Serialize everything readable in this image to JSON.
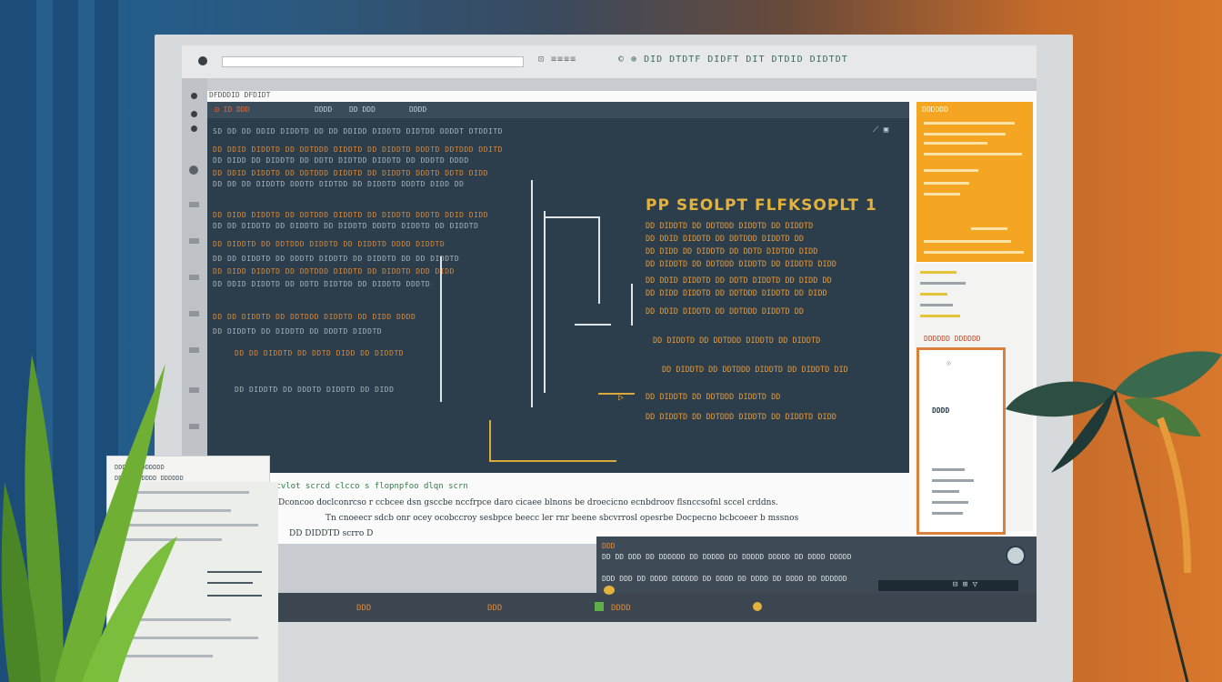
{
  "browser": {
    "toolbar_text": "© ⊕ DID DTDTF DIDFT DIT  DTDID DIDTDT"
  },
  "breadcrumb": "DFDDDID DFDIDT",
  "editor": {
    "tabs": [
      {
        "label": "⊡ ID  DDD"
      },
      {
        "label": "DDDD"
      },
      {
        "label": "DD DDD"
      },
      {
        "label": "DDDD"
      }
    ],
    "code_lines": [
      "SD DD DD  DDID DIDDTD  DD DD DDIDD DIDDTD DIDTDD DDDDT DTDDITD",
      "DD DDID DIDDTD  DD DDTDDD DIDDTD DD DIDDTD DDDTD DDTDDD DDITD",
      "DD DIDD DD DIDDTD DD DDTD DIDTDD DIDDTD DD DDDTD DDDD",
      "DD DDID DIDDTD DD DDTDDD DIDDTD DD DIDDTD DDDTD DDTD DIDD",
      "DD DD DD DIDDTD DDDTD DIDTDD DD DIDDTD DDDTD DIDD DD",
      "DD DIDD DIDDTD DD DDTDDD DIDDTD DD DIDDTD DDDTD DDID DIDD",
      "DD DD DIDDTD DD DIDDTD DD DIDDTD DDDTD DIDDTD DD DIDDTD",
      "DD DIDDTD DD DDTDDD DIDDTD DD DIDDTD DDDD DIDDTD",
      "DD DD DIDDTD DD DDDTD DIDDTD DD DIDDTD DD DD DIDDTD",
      "DD DIDD DIDDTD DD DDTDDD DIDDTD DD DIDDTD DDD DIDD",
      "DD DDID DIDDTD DD DDTD DIDTDD DD DIDDTD DDDTD",
      "DD DD DIDDTD DD DDTDDD DIDDTD DD DIDD DDDD",
      "DD DIDDTD DD DIDDTD DD DDDTD DIDDTD",
      "DD DD DIDDTD DD DDTD DIDD DD DIDDTD",
      "DD DIDDTD DD DDDTD DIDDTD DD DIDD"
    ],
    "panel_title": "PP SEOLPT FLFKSOPLT 1",
    "panel_lines": [
      "DD DIDDTD DD DDTDDD DIDDTD DD DIDDTD",
      "DD DDID DIDDTD DD DDTDDD DIDDTD DD",
      "DD DIDD DD DIDDTD DD DDTD DIDTDD DIDD",
      "DD DIDDTD DD DDTDDD DIDDTD DD DIDDTD DIDD",
      "DD DDID DIDDTD DD DDTD DIDDTD DD DIDD DD",
      "DD DIDD DIDDTD DD DDTDDD DIDDTD DD DIDD",
      "DD DDID DIDDTD DD DDTDDD DIDDTD DD",
      "DD DIDDTD DD DDTDDD DIDDTD DD DIDDTD",
      "DD DIDDTD DD DDTDDD DIDDTD DD DIDDTD DID",
      "DD DIDDTD DD DDTDDD DIDDTD DD",
      "DD DIDDTD DD DDTDDD DIDDTD DD DIDDTD DIDD"
    ]
  },
  "right_panel": {
    "card_title": "DDDDDD",
    "doc_header": "DDDDDD DDDDDD",
    "doc_label": "DDDD"
  },
  "description": {
    "heading": "Dcvlot scrcd clcco s flopnpfoo dlqn scrn",
    "lines": [
      "Dconcoo doclconrcso r ccbcee dsn gsccbe nccfrpce daro cicaee blnons be  droecicno ecnbdroov flsnccsofnl sccel crddns.",
      "Tn cnoeecr sdcb  onr ocey ocobccroy sesbpce beecc ler rnr beene  sbcvrrosl  opesrbe  Docpecno bcbcoeer b mssnos",
      "DD DIDDTD scrro  D"
    ]
  },
  "status_panel": {
    "lines": [
      "DD  DD DDD  DD DDDDDD DD DDDDD DD DDDDD DDDDD DD DDDD DDDDD",
      "DDD DDD DD DDDD DDDDDD DD DDDD DD DDDD DD DDDD DD DDDDDD"
    ]
  },
  "dock": {
    "items": [
      "DDD",
      "DDD",
      "DDDD"
    ]
  },
  "paper": {
    "title": "DDDDDD  DDDDDD",
    "subtitle": "DDDDD DDDDD DDDDDD"
  },
  "colors": {
    "editor_bg": "#2c3d4b",
    "code_orange": "#d98a3a",
    "title_yellow": "#e3b23c",
    "card_amber": "#f4a623"
  }
}
